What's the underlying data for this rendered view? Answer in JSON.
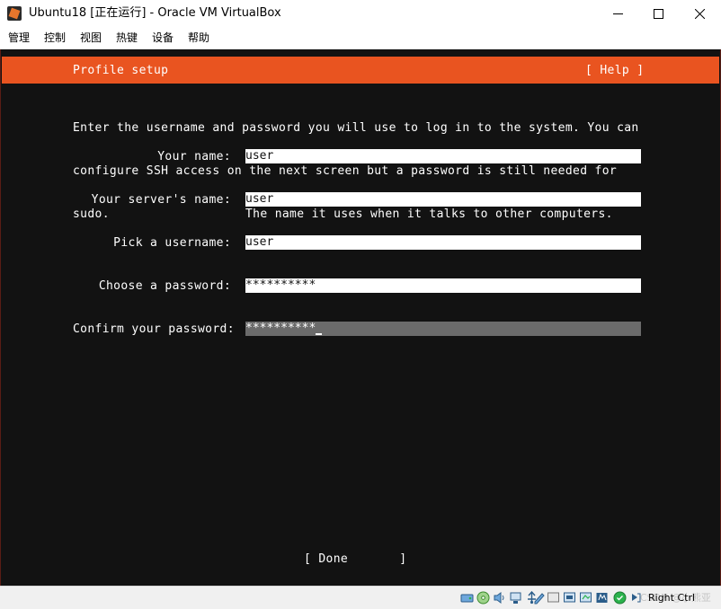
{
  "window": {
    "title": "Ubuntu18 [正在运行] - Oracle VM VirtualBox"
  },
  "menu": [
    "管理",
    "控制",
    "视图",
    "热键",
    "设备",
    "帮助"
  ],
  "installer": {
    "header_title": "Profile setup",
    "help_label": "[ Help ]",
    "intro_lines": [
      "Enter the username and password you will use to log in to the system. You can",
      "configure SSH access on the next screen but a password is still needed for",
      "sudo."
    ],
    "fields": [
      {
        "label": "Your name:",
        "value": "user",
        "hint": ""
      },
      {
        "label": "Your server's name:",
        "value": "user",
        "hint": "The name it uses when it talks to other computers."
      },
      {
        "label": "Pick a username:",
        "value": "user",
        "hint": ""
      },
      {
        "label": "Choose a password:",
        "value": "**********",
        "hint": ""
      },
      {
        "label": "Confirm your password:",
        "value": "**********",
        "hint": ""
      }
    ],
    "done_label": "[ Done       ]"
  },
  "status": {
    "host_key": "Right Ctrl",
    "watermark": "CSDN @小熊亚",
    "tray_icons": [
      "hard-disk-icon",
      "optical-drive-icon",
      "audio-icon",
      "network-icon",
      "usb-icon",
      "shared-folders-icon",
      "display-icon",
      "video-capture-icon",
      "cpu-icon",
      "mouse-integration-icon",
      "keyboard-icon"
    ]
  },
  "colors": {
    "header": "#e95420",
    "console_background": "#121212"
  }
}
